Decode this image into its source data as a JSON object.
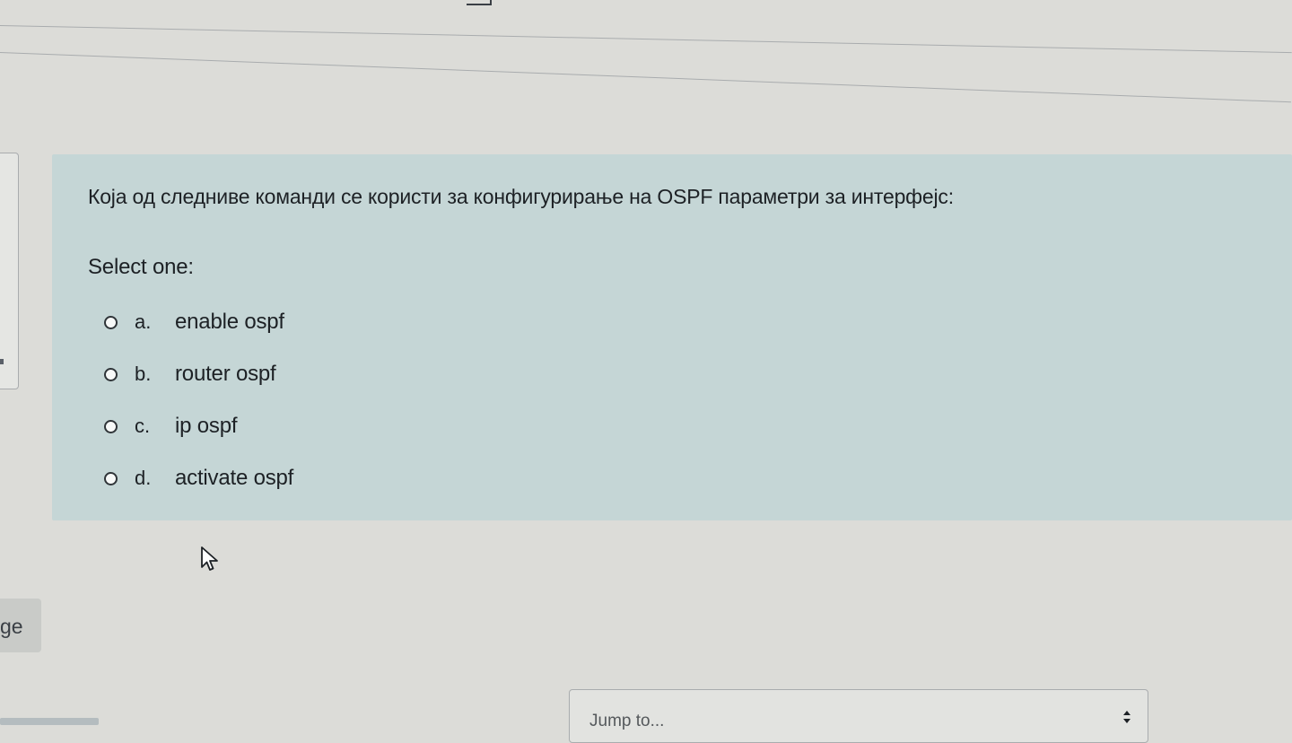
{
  "question": {
    "text": "Која од следниве команди се користи за конфигурирање на OSPF параметри за интерфејс:",
    "prompt": "Select one:",
    "answers": [
      {
        "letter": "a.",
        "text": "enable ospf"
      },
      {
        "letter": "b.",
        "text": "router ospf"
      },
      {
        "letter": "c.",
        "text": "ip ospf"
      },
      {
        "letter": "d.",
        "text": "activate ospf"
      }
    ]
  },
  "nav": {
    "page_button_label": "ge",
    "jump_placeholder": "Jump to..."
  },
  "icons": {
    "cursor": "mouse-pointer-icon",
    "select_arrows": "updown-arrows-icon"
  },
  "colors": {
    "card_background": "#c5d6d6",
    "page_background": "#dcdcd8"
  }
}
